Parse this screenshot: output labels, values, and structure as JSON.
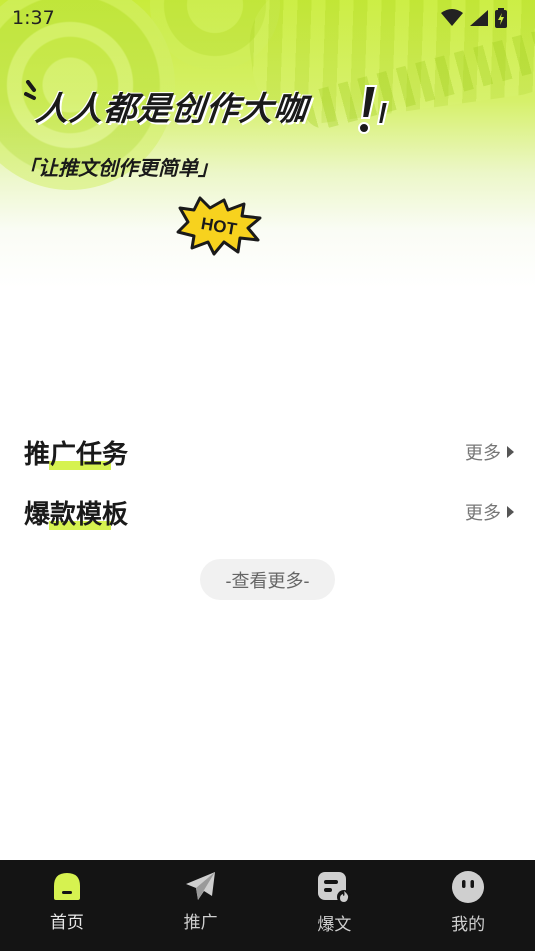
{
  "status_bar": {
    "time": "1:37"
  },
  "hero": {
    "headline": "人人都是创作大咖",
    "exclaim": "!",
    "subtitle": "「让推文创作更简单」",
    "hot_badge": "HOT"
  },
  "sections": [
    {
      "title": "推广任务",
      "more": "更多"
    },
    {
      "title": "爆款模板",
      "more": "更多"
    }
  ],
  "view_more": "-查看更多-",
  "tabs": [
    {
      "label": "首页",
      "icon": "home-icon",
      "active": true
    },
    {
      "label": "推广",
      "icon": "paper-plane-icon",
      "active": false
    },
    {
      "label": "爆文",
      "icon": "hot-article-icon",
      "active": false
    },
    {
      "label": "我的",
      "icon": "profile-face-icon",
      "active": false
    }
  ],
  "colors": {
    "accent": "#d6f250",
    "hero_green": "#c9ec3a",
    "tabbar_bg": "#141414",
    "hot_yellow": "#f7d21e"
  }
}
